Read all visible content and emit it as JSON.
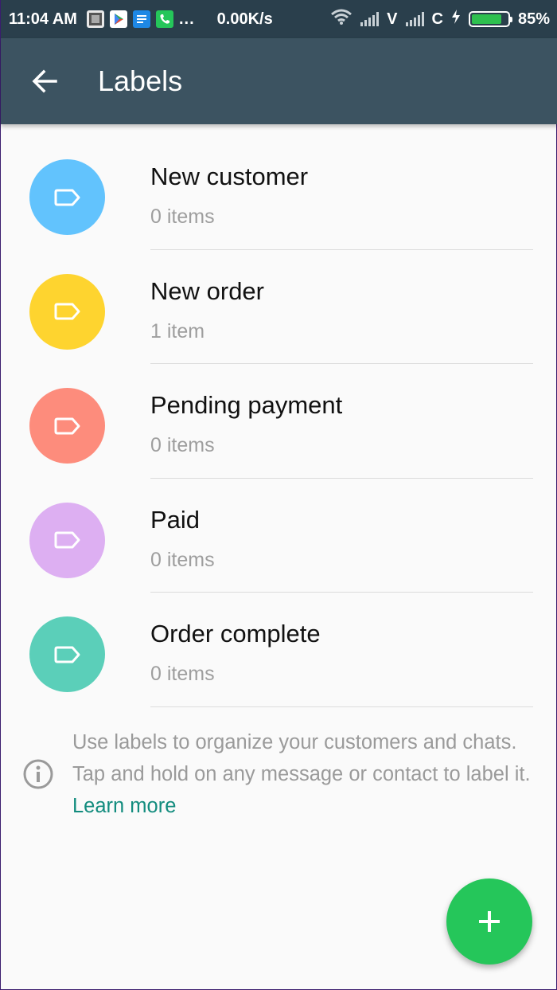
{
  "status_bar": {
    "time": "11:04 AM",
    "dots": "...",
    "speed": "0.00K/s",
    "carrier1": "V",
    "carrier2": "C",
    "battery_percent": "85%",
    "battery_level": 0.85,
    "icons": [
      "gallery-icon",
      "play-store-icon",
      "docs-icon",
      "phone-icon",
      "wifi-icon",
      "signal-icon",
      "charging-icon",
      "battery-icon"
    ]
  },
  "app_bar": {
    "title": "Labels",
    "back_icon": "arrow-left-icon",
    "background": "#3c5361"
  },
  "labels": [
    {
      "name": "New customer",
      "count": "0 items",
      "color": "#62c3fd",
      "icon": "label-tag-icon"
    },
    {
      "name": "New order",
      "count": "1 item",
      "color": "#fed42f",
      "icon": "label-tag-icon"
    },
    {
      "name": "Pending payment",
      "count": "0 items",
      "color": "#fd8c7c",
      "icon": "label-tag-icon"
    },
    {
      "name": "Paid",
      "count": "0 items",
      "color": "#ddaff2",
      "icon": "label-tag-icon"
    },
    {
      "name": "Order complete",
      "count": "0 items",
      "color": "#5bcfb9",
      "icon": "label-tag-icon"
    }
  ],
  "info": {
    "icon": "info-icon",
    "text": "Use labels to organize your customers and chats. Tap and hold on any message or contact to label it.",
    "link": "Learn more",
    "link_color": "#128c7e"
  },
  "fab": {
    "icon": "plus-icon",
    "color": "#25c65a"
  }
}
